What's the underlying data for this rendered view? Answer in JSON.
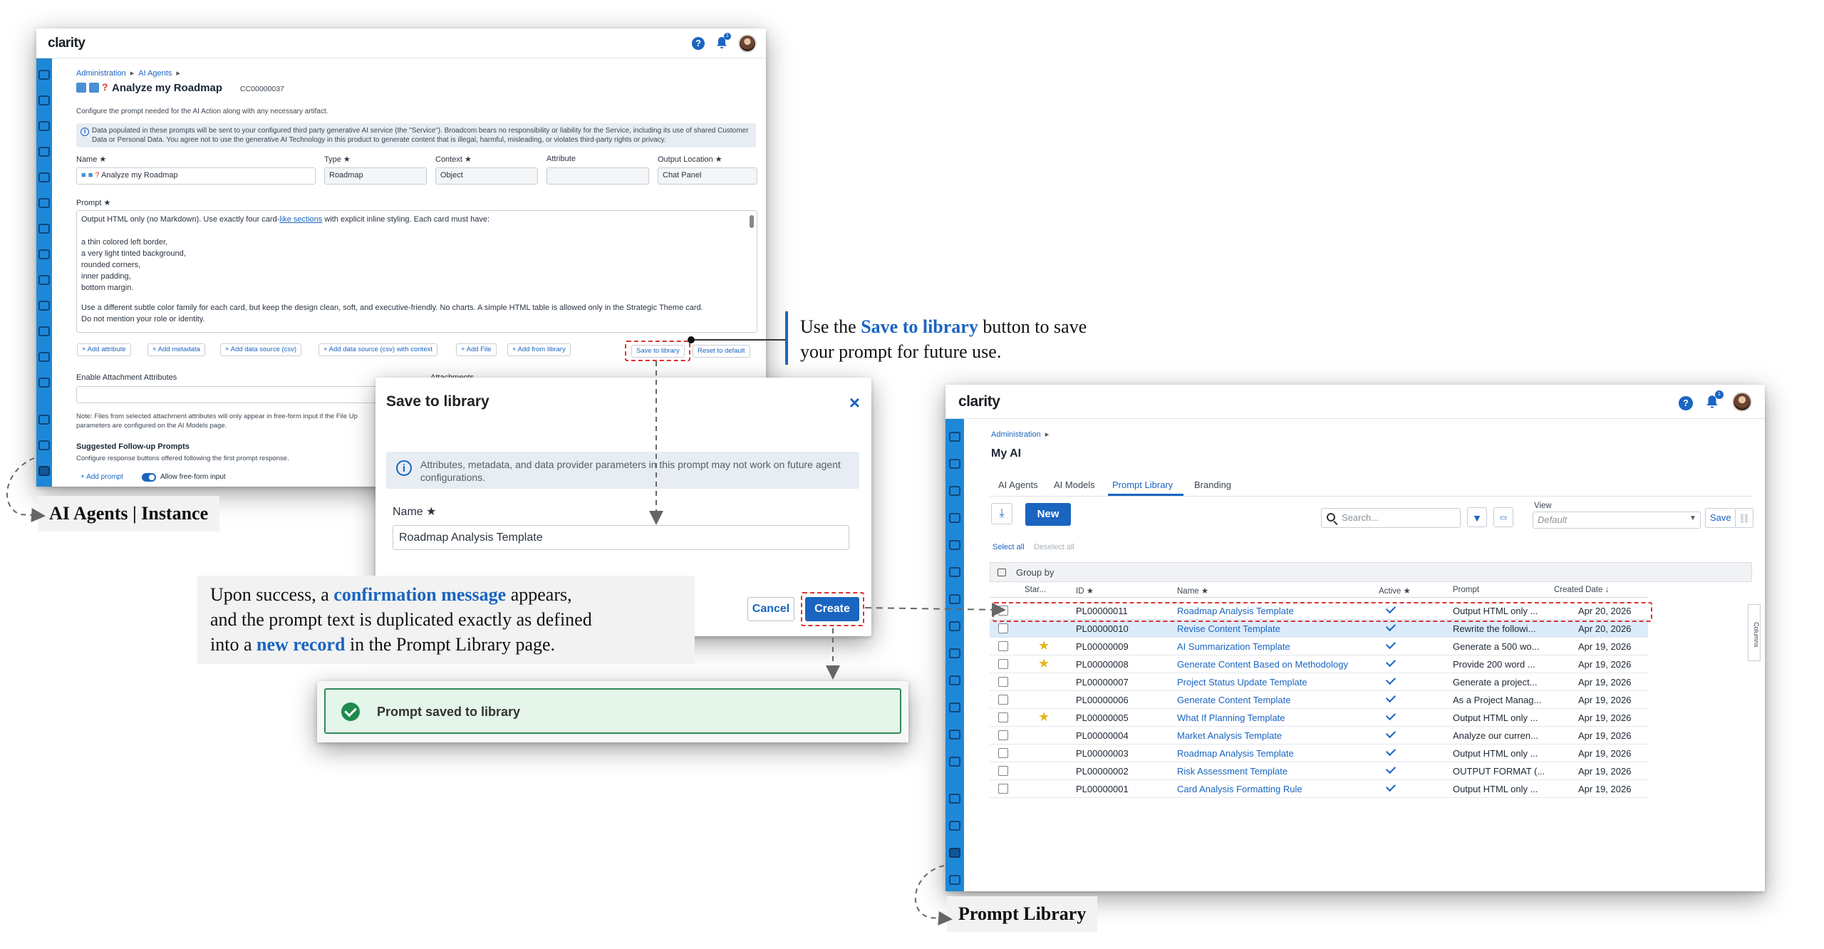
{
  "app": {
    "logo": "clarity",
    "help_icon": "?",
    "notif_count": "1"
  },
  "w1": {
    "breadcrumb": [
      "Administration",
      "AI Agents"
    ],
    "title": "Analyze my Roadmap",
    "code": "CC00000037",
    "description": "Configure the prompt needed for the AI Action along with any necessary artifact.",
    "disclaimer": "Data populated in these prompts will be sent to your configured third party generative AI service (the \"Service\"). Broadcom bears no responsibility or liability for the Service, including its use of shared Customer Data or Personal Data. You agree not to use the generative AI Technology in this product to generate content that is illegal, harmful, misleading, or violates third-party rights or privacy.",
    "fields": {
      "name_label": "Name ★",
      "name_value": "Analyze my Roadmap",
      "type_label": "Type ★",
      "type_value": "Roadmap",
      "context_label": "Context ★",
      "context_value": "Object",
      "attribute_label": "Attribute",
      "attribute_value": "",
      "output_label": "Output Location ★",
      "output_value": "Chat Panel"
    },
    "prompt_label": "Prompt ★",
    "prompt_line1_a": "Output HTML only (no Markdown). Use exactly four card-",
    "prompt_line1_b": "like  sections",
    "prompt_line1_c": " with explicit inline styling. Each card must have:",
    "prompt_lines": [
      "a thin colored left border,",
      "a very light tinted background,",
      "rounded corners,",
      "inner padding,",
      "bottom margin."
    ],
    "prompt_tail1": "Use a different subtle color family for each card, but keep the design clean, soft, and executive-friendly. No charts. A simple HTML table is allowed only in the Strategic Theme card.",
    "prompt_tail2": "Do not mention your role or identity.",
    "buttons": [
      "+ Add attribute",
      "+ Add metadata",
      "+ Add data source (csv)",
      "+ Add data source (csv) with context",
      "+ Add File",
      "+ Add from library"
    ],
    "save_to_library": "Save to library",
    "reset_default": "Reset to default",
    "attach_label": "Enable Attachment Attributes",
    "attachments_label": "Attachments",
    "note": "Note: Files from selected attachment attributes will only appear in free-form input if the File Up",
    "note2": "parameters are configured on the AI Models page.",
    "followup_title": "Suggested Follow-up Prompts",
    "followup_desc": "Configure response buttons offered following the first prompt response.",
    "add_prompt": "+ Add prompt",
    "allow_freeform": "Allow free-form input"
  },
  "modal": {
    "title": "Save to library",
    "close": "×",
    "info": "Attributes, metadata, and data provider parameters in this prompt may not work on future agent configurations.",
    "name_label": "Name ★",
    "name_value": "Roadmap Analysis Template",
    "cancel": "Cancel",
    "create": "Create"
  },
  "toast": {
    "message": "Prompt saved to library"
  },
  "w2": {
    "breadcrumb": "Administration",
    "title": "My AI",
    "tabs": [
      "AI Agents",
      "AI Models",
      "Prompt Library",
      "Branding"
    ],
    "active_tab": 2,
    "new": "New",
    "search_placeholder": "Search...",
    "view_label": "View",
    "view_value": "Default",
    "save": "Save",
    "select_all": "Select all",
    "deselect_all": "Deselect all",
    "group_by": "Group by",
    "columns_flap": "Columns",
    "headers": [
      "Star...",
      "ID ★",
      "Name ★",
      "Active ★",
      "Prompt",
      "Created Date ↓"
    ],
    "rows": [
      {
        "star": false,
        "id": "PL00000011",
        "name": "Roadmap Analysis Template",
        "prompt": "Output HTML only ...",
        "date": "Apr 20, 2026",
        "sel": false
      },
      {
        "star": false,
        "id": "PL00000010",
        "name": "Revise Content Template",
        "prompt": "Rewrite the followi...",
        "date": "Apr 20, 2026",
        "sel": true
      },
      {
        "star": true,
        "id": "PL00000009",
        "name": "AI Summarization Template",
        "prompt": "Generate a 500 wo...",
        "date": "Apr 19, 2026",
        "sel": false
      },
      {
        "star": true,
        "id": "PL00000008",
        "name": "Generate Content Based on Methodology",
        "prompt": "Provide 200 word ...",
        "date": "Apr 19, 2026",
        "sel": false
      },
      {
        "star": false,
        "id": "PL00000007",
        "name": "Project Status Update Template",
        "prompt": "Generate a project...",
        "date": "Apr 19, 2026",
        "sel": false
      },
      {
        "star": false,
        "id": "PL00000006",
        "name": "Generate Content Template",
        "prompt": "As a Project Manag...",
        "date": "Apr 19, 2026",
        "sel": false
      },
      {
        "star": true,
        "id": "PL00000005",
        "name": "What If Planning Template",
        "prompt": "Output HTML only ...",
        "date": "Apr 19, 2026",
        "sel": false
      },
      {
        "star": false,
        "id": "PL00000004",
        "name": "Market Analysis Template",
        "prompt": "Analyze our curren...",
        "date": "Apr 19, 2026",
        "sel": false
      },
      {
        "star": false,
        "id": "PL00000003",
        "name": "Roadmap Analysis Template",
        "prompt": "Output HTML only ...",
        "date": "Apr 19, 2026",
        "sel": false
      },
      {
        "star": false,
        "id": "PL00000002",
        "name": "Risk Assessment Template",
        "prompt": "OUTPUT FORMAT (...",
        "date": "Apr 19, 2026",
        "sel": false
      },
      {
        "star": false,
        "id": "PL00000001",
        "name": "Card Analysis Formatting Rule",
        "prompt": "Output HTML only ...",
        "date": "Apr 19, 2026",
        "sel": false
      }
    ]
  },
  "annotations": {
    "save_a": "Use the ",
    "save_b": "Save to library",
    "save_c": " button to save",
    "save_d": "your prompt for future use.",
    "succ_a": "Upon success, a ",
    "succ_b": "confirmation message",
    "succ_c": " appears,",
    "succ_d": "and the prompt text is duplicated exactly as defined",
    "succ_e": "into a ",
    "succ_f": "new record",
    "succ_g": " in the Prompt Library page.",
    "tag1": "AI Agents | Instance",
    "tag2": "Prompt Library"
  },
  "colors": {
    "accent": "#1a65c0",
    "rail": "#1e88d8",
    "success": "#1f8a4c",
    "highlight": "#d33333"
  }
}
